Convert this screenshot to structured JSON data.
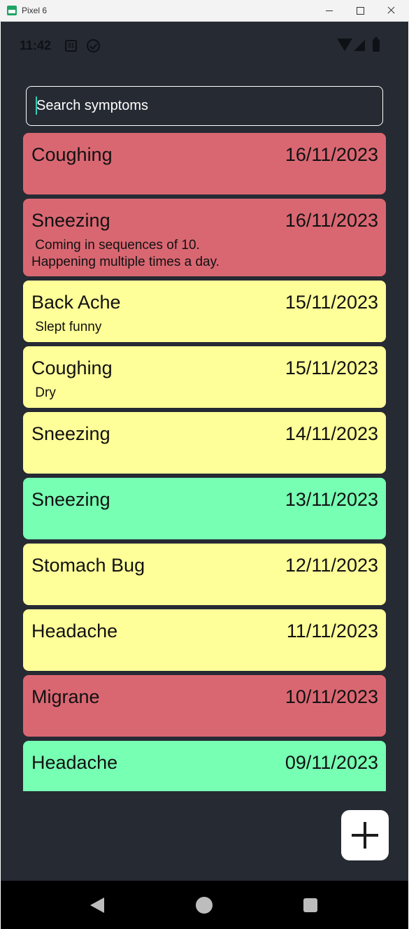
{
  "window": {
    "title": "Pixel 6",
    "app_icon": "android-studio-emulator-icon",
    "buttons": [
      "minimize-icon",
      "maximize-icon",
      "close-icon"
    ]
  },
  "status_bar": {
    "time": "11:42",
    "calendar_day": "31",
    "icons": [
      "calendar-icon",
      "check-circle-icon",
      "wifi-icon",
      "signal-icon",
      "battery-icon"
    ]
  },
  "search": {
    "placeholder": "Search symptoms",
    "value": ""
  },
  "colors": {
    "background": "#262a33",
    "severity_high": "#d96772",
    "severity_medium": "#ffff99",
    "severity_low": "#77ffb3"
  },
  "symptoms": [
    {
      "name": "Coughing",
      "date": "16/11/2023",
      "note": "",
      "severity": "high"
    },
    {
      "name": "Sneezing",
      "date": "16/11/2023",
      "note": " Coming in sequences of 10.\nHappening multiple times a day.",
      "severity": "high"
    },
    {
      "name": "Back Ache",
      "date": "15/11/2023",
      "note": " Slept funny",
      "severity": "medium"
    },
    {
      "name": "Coughing",
      "date": "15/11/2023",
      "note": " Dry",
      "severity": "medium"
    },
    {
      "name": "Sneezing",
      "date": "14/11/2023",
      "note": "",
      "severity": "medium"
    },
    {
      "name": "Sneezing",
      "date": "13/11/2023",
      "note": "",
      "severity": "low"
    },
    {
      "name": "Stomach Bug",
      "date": "12/11/2023",
      "note": "",
      "severity": "medium"
    },
    {
      "name": "Headache",
      "date": "11/11/2023",
      "note": "",
      "severity": "medium"
    },
    {
      "name": "Migrane",
      "date": "10/11/2023",
      "note": "",
      "severity": "high"
    },
    {
      "name": "Headache",
      "date": "09/11/2023",
      "note": "",
      "severity": "low"
    }
  ],
  "fab": {
    "icon": "plus-icon"
  },
  "nav_bar": {
    "icons": [
      "back-icon",
      "home-icon",
      "recents-icon"
    ]
  }
}
